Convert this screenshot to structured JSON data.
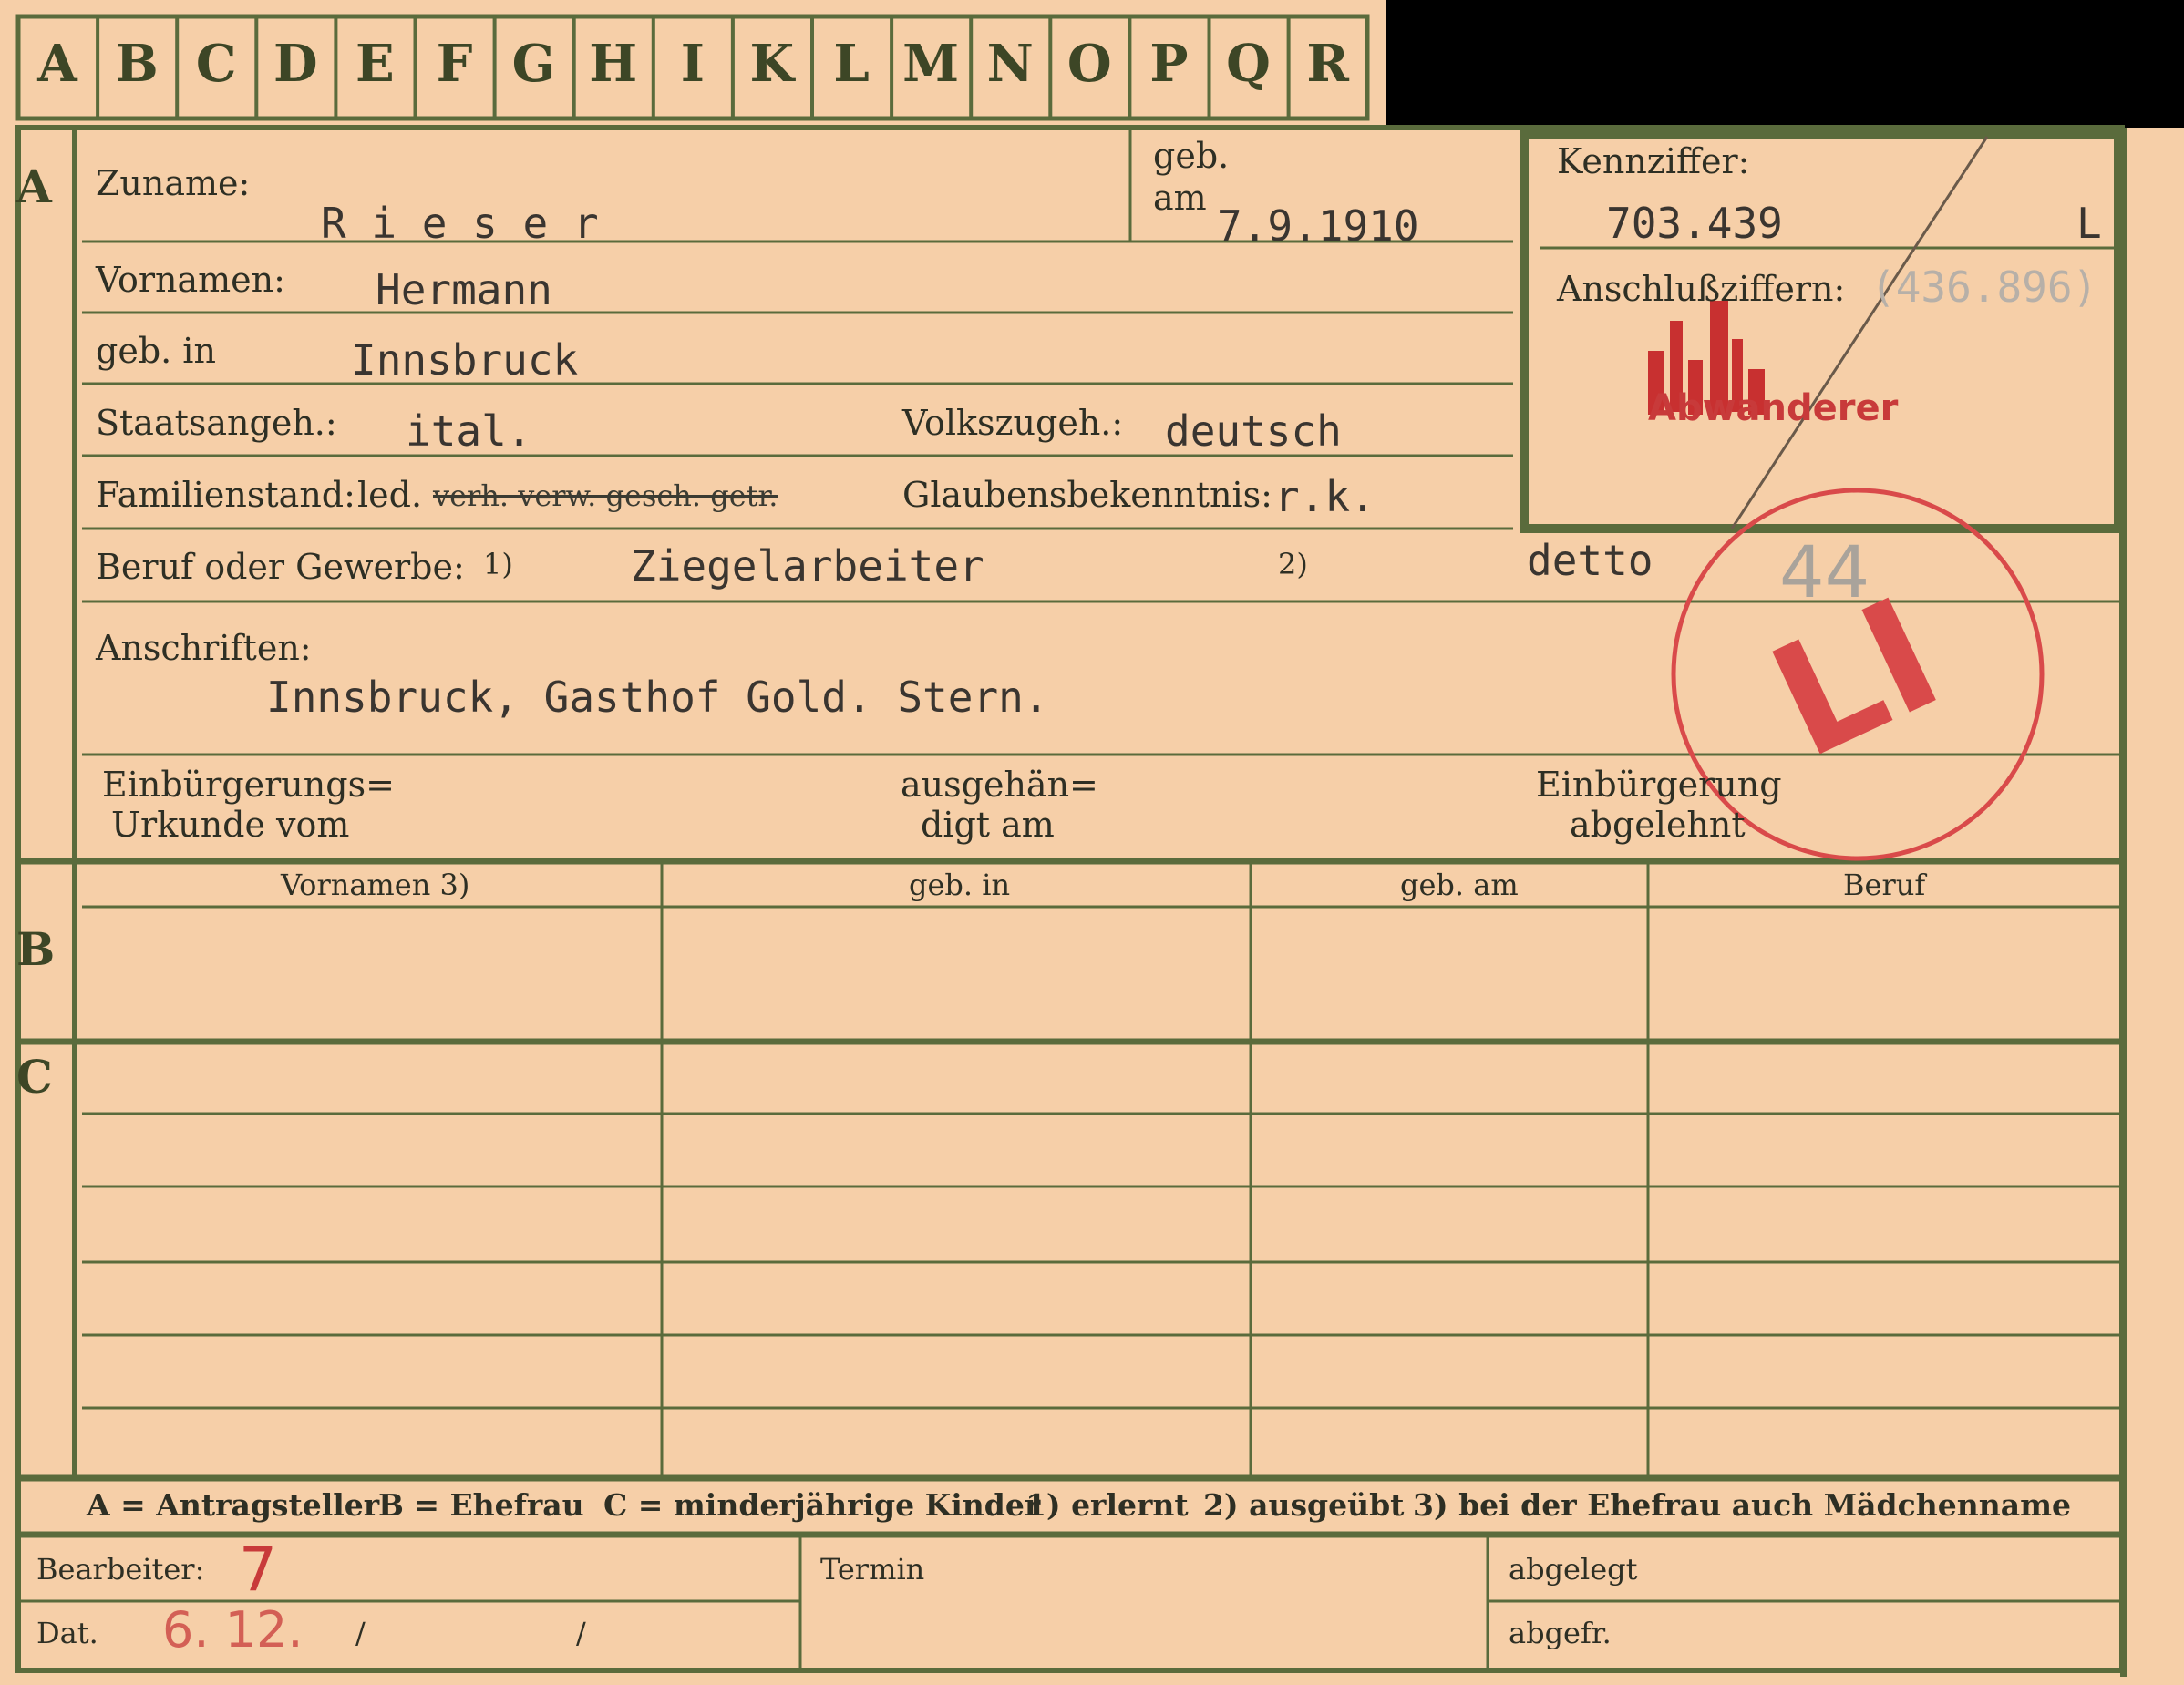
{
  "tabs": [
    "A",
    "B",
    "C",
    "D",
    "E",
    "F",
    "G",
    "H",
    "I",
    "K",
    "L",
    "M",
    "N",
    "O",
    "P",
    "Q",
    "R"
  ],
  "section_a": {
    "marker": "A",
    "zuname_label": "Zuname:",
    "zuname_value": "R i e s e r",
    "geb_label_1": "geb.",
    "geb_label_2": "am",
    "geb_value": "7.9.1910",
    "vornamen_label": "Vornamen:",
    "vornamen_value": "Hermann",
    "geb_in_label": "geb. in",
    "geb_in_value": "Innsbruck",
    "staatsangeh_label": "Staatsangeh.:",
    "staatsangeh_value": "ital.",
    "volkszugeh_label": "Volkszugeh.:",
    "volkszugeh_value": "deutsch",
    "familienstand_label": "Familienstand:",
    "familienstand_value": "led.",
    "familienstand_struck": "verh. verw. gesch. getr.",
    "glaubens_label": "Glaubensbekenntnis:",
    "glaubens_value": "r.k.",
    "beruf_label": "Beruf oder Gewerbe:",
    "beruf_sup1": "1)",
    "beruf_value1": "Ziegelarbeiter",
    "beruf_sup2": "2)",
    "beruf_value2": "detto",
    "anschriften_label": "Anschriften:",
    "anschriften_value": "Innsbruck, Gasthof Gold. Stern.",
    "einb_label_1": "Einbürgerungs=",
    "einb_label_2": "Urkunde vom",
    "ausgeh_label_1": "ausgehän=",
    "ausgeh_label_2": "digt am",
    "abgelehnt_label_1": "Einbürgerung",
    "abgelehnt_label_2": "abgelehnt"
  },
  "kennziffer": {
    "label": "Kennziffer:",
    "value": "703.439",
    "suffix": "L",
    "anschluss_label": "Anschlußziffern:",
    "anschluss_value": "(436.896)",
    "stamp_text": "Abwanderer"
  },
  "circle_stamp": {
    "handwritten": "44",
    "letters": "LI",
    "color": "#d94a4a"
  },
  "section_b": {
    "marker": "B",
    "headers": [
      "Vornamen 3)",
      "geb. in",
      "geb. am",
      "Beruf"
    ]
  },
  "section_c": {
    "marker": "C"
  },
  "legend": {
    "a": "A = Antragsteller",
    "b": "B = Ehefrau",
    "c": "C = minderjährige Kinder",
    "n1": "1) erlernt",
    "n2": "2) ausgeübt",
    "n3": "3) bei der Ehefrau auch Mädchenname"
  },
  "footer": {
    "bearbeiter_label": "Bearbeiter:",
    "bearbeiter_value": "7",
    "dat_label": "Dat.",
    "dat_value": "6. 12.",
    "slash1": "/",
    "slash2": "/",
    "termin_label": "Termin",
    "abgelegt_label": "abgelegt",
    "abgefr_label": "abgefr."
  }
}
